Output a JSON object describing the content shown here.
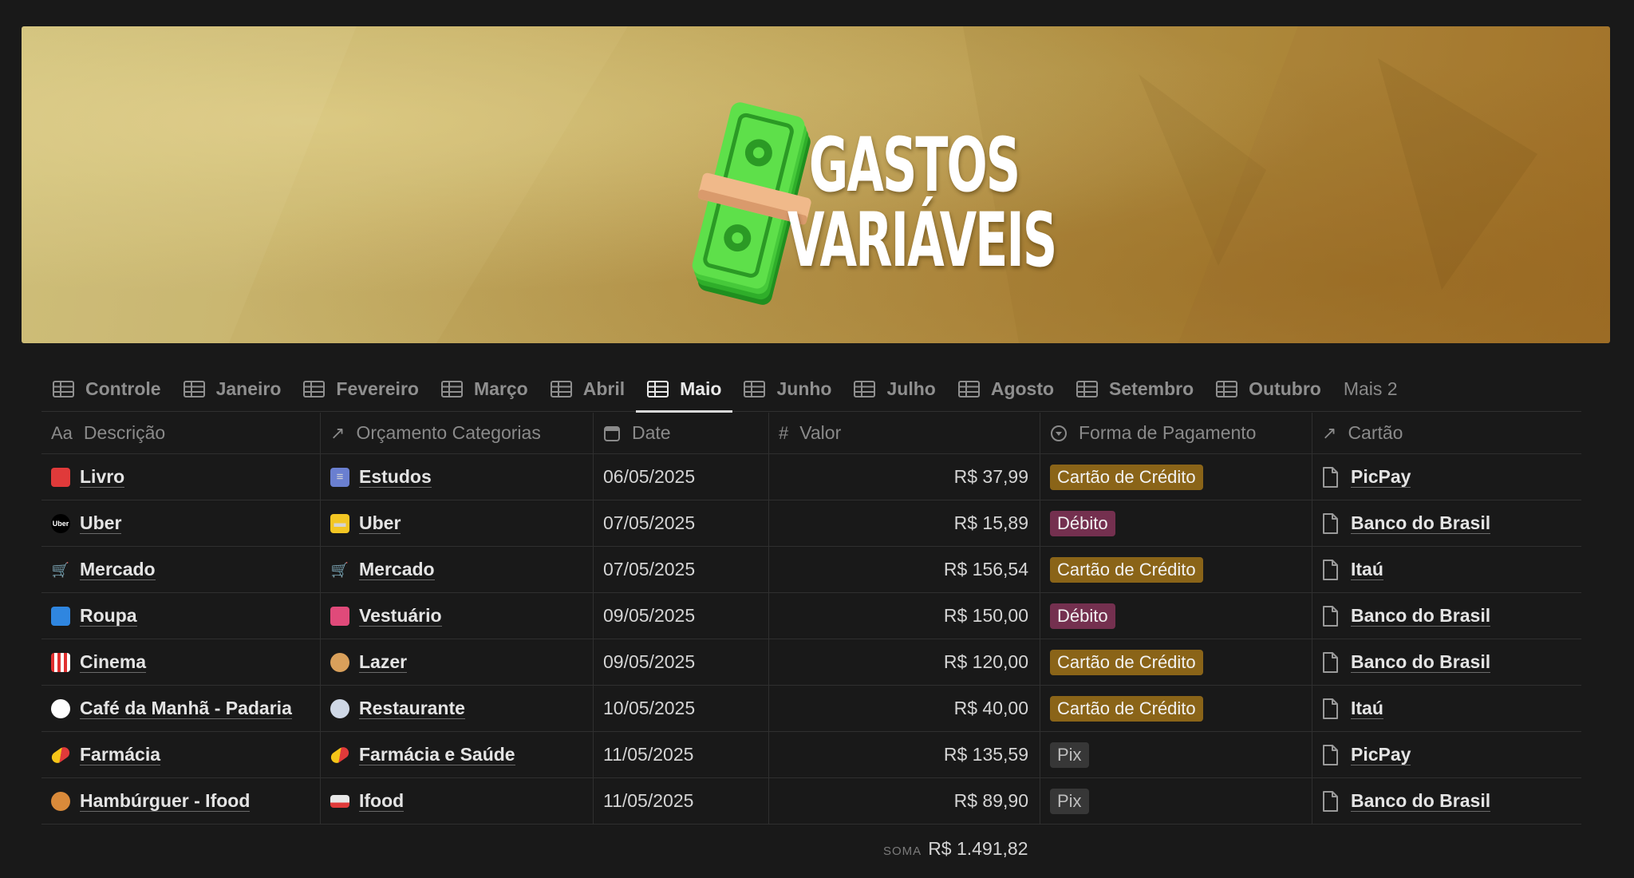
{
  "cover": {
    "title_line1": "GASTOS",
    "title_line2": "VARIÁVEIS",
    "art_icon": "money-stack-icon"
  },
  "tabs": [
    {
      "label": "Controle",
      "icon": "table-icon",
      "active": false
    },
    {
      "label": "Janeiro",
      "icon": "table-icon",
      "active": false
    },
    {
      "label": "Fevereiro",
      "icon": "table-icon",
      "active": false
    },
    {
      "label": "Março",
      "icon": "table-icon",
      "active": false
    },
    {
      "label": "Abril",
      "icon": "table-icon",
      "active": false
    },
    {
      "label": "Maio",
      "icon": "table-icon",
      "active": true
    },
    {
      "label": "Junho",
      "icon": "table-icon",
      "active": false
    },
    {
      "label": "Julho",
      "icon": "table-icon",
      "active": false
    },
    {
      "label": "Agosto",
      "icon": "table-icon",
      "active": false
    },
    {
      "label": "Setembro",
      "icon": "table-icon",
      "active": false
    },
    {
      "label": "Outubro",
      "icon": "table-icon",
      "active": false
    }
  ],
  "tabs_more": "Mais 2",
  "columns": {
    "descricao": {
      "icon": "Aa",
      "label": "Descrição"
    },
    "orcamento": {
      "icon": "↗",
      "label": "Orçamento Categorias"
    },
    "date": {
      "icon": "calendar-icon",
      "label": "Date"
    },
    "valor": {
      "icon": "#",
      "label": "Valor"
    },
    "forma": {
      "icon": "status-icon",
      "label": "Forma de Pagamento"
    },
    "cartao": {
      "icon": "↗",
      "label": "Cartão"
    }
  },
  "badge_colors": {
    "Cartão de Crédito": "#8a6418",
    "Débito": "#74304f",
    "Pix": "#373737"
  },
  "rows": [
    {
      "descricao": "Livro",
      "desc_icon": "book-icon",
      "categoria": "Estudos",
      "cat_icon": "books-icon",
      "date": "06/05/2025",
      "valor": "R$ 37,99",
      "forma": "Cartão de Crédito",
      "cartao": "PicPay"
    },
    {
      "descricao": "Uber",
      "desc_icon": "uber-logo-icon",
      "categoria": "Uber",
      "cat_icon": "taxi-icon",
      "date": "07/05/2025",
      "valor": "R$ 15,89",
      "forma": "Débito",
      "cartao": "Banco do Brasil"
    },
    {
      "descricao": "Mercado",
      "desc_icon": "cart-icon",
      "categoria": "Mercado",
      "cat_icon": "cart-icon",
      "date": "07/05/2025",
      "valor": "R$ 156,54",
      "forma": "Cartão de Crédito",
      "cartao": "Itaú"
    },
    {
      "descricao": "Roupa",
      "desc_icon": "tshirt-icon",
      "categoria": "Vestuário",
      "cat_icon": "shopping-bags-icon",
      "date": "09/05/2025",
      "valor": "R$ 150,00",
      "forma": "Débito",
      "cartao": "Banco do Brasil"
    },
    {
      "descricao": "Cinema",
      "desc_icon": "popcorn-icon",
      "categoria": "Lazer",
      "cat_icon": "palette-icon",
      "date": "09/05/2025",
      "valor": "R$ 120,00",
      "forma": "Cartão de Crédito",
      "cartao": "Banco do Brasil"
    },
    {
      "descricao": "Café da Manhã - Padaria",
      "desc_icon": "coffee-icon",
      "categoria": "Restaurante",
      "cat_icon": "plate-icon",
      "date": "10/05/2025",
      "valor": "R$ 40,00",
      "forma": "Cartão de Crédito",
      "cartao": "Itaú"
    },
    {
      "descricao": "Farmácia",
      "desc_icon": "pill-icon",
      "categoria": "Farmácia e Saúde",
      "cat_icon": "pill-icon",
      "date": "11/05/2025",
      "valor": "R$ 135,59",
      "forma": "Pix",
      "cartao": "PicPay"
    },
    {
      "descricao": "Hambúrguer - Ifood",
      "desc_icon": "burger-icon",
      "categoria": "Ifood",
      "cat_icon": "delivery-truck-icon",
      "date": "11/05/2025",
      "valor": "R$ 89,90",
      "forma": "Pix",
      "cartao": "Banco do Brasil"
    }
  ],
  "sum": {
    "label": "SOMA",
    "value": "R$ 1.491,82"
  }
}
